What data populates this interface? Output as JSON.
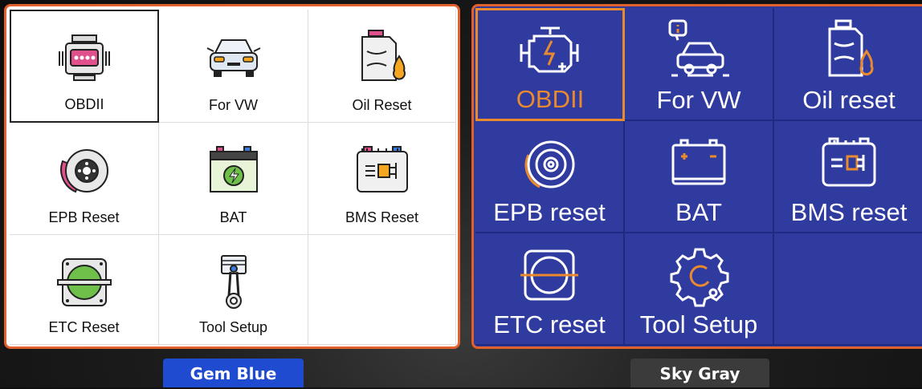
{
  "themes": {
    "gem_blue": {
      "name": "Gem Blue",
      "accent": "#e2602c",
      "items": [
        {
          "label": "OBDII",
          "icon": "engine-icon",
          "selected": true
        },
        {
          "label": "For VW",
          "icon": "car-front-icon"
        },
        {
          "label": "Oil Reset",
          "icon": "oil-can-icon"
        },
        {
          "label": "EPB Reset",
          "icon": "brake-disc-icon"
        },
        {
          "label": "BAT",
          "icon": "battery-icon"
        },
        {
          "label": "BMS Reset",
          "icon": "bms-module-icon"
        },
        {
          "label": "ETC Reset",
          "icon": "throttle-body-icon"
        },
        {
          "label": "Tool Setup",
          "icon": "piston-icon"
        }
      ]
    },
    "sky_gray": {
      "name": "Sky Gray",
      "accent": "#e98a2e",
      "background": "#2f3b9e",
      "items": [
        {
          "label": "OBDII",
          "icon": "engine-icon",
          "selected": true
        },
        {
          "label": "For VW",
          "icon": "car-info-icon"
        },
        {
          "label": "Oil reset",
          "icon": "oil-can-icon"
        },
        {
          "label": "EPB reset",
          "icon": "brake-disc-icon"
        },
        {
          "label": "BAT",
          "icon": "battery-icon"
        },
        {
          "label": "BMS reset",
          "icon": "bms-module-icon"
        },
        {
          "label": "ETC reset",
          "icon": "throttle-body-icon"
        },
        {
          "label": "Tool Setup",
          "icon": "gear-icon"
        }
      ]
    }
  }
}
